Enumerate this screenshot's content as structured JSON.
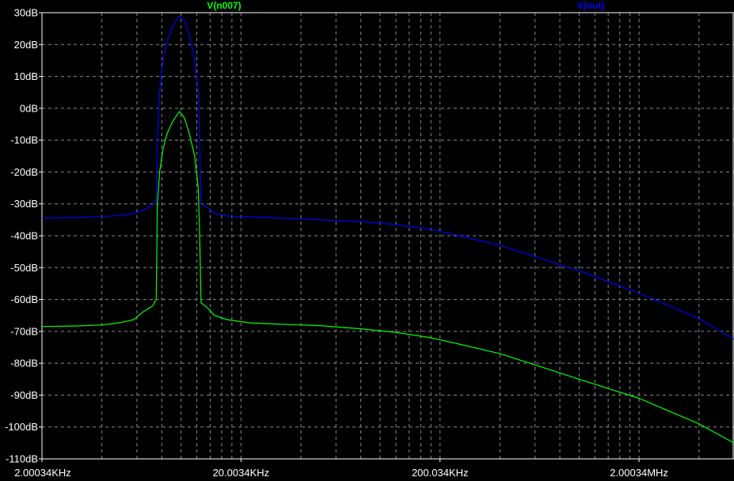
{
  "chart_data": {
    "type": "line",
    "title": "",
    "xlabel": "",
    "ylabel": "",
    "x_scale": "log",
    "xlim": [
      2000.34,
      6000000
    ],
    "ylim": [
      -110,
      30
    ],
    "y_tick_step": 10,
    "y_ticks": [
      30,
      20,
      10,
      0,
      -10,
      -20,
      -30,
      -40,
      -50,
      -60,
      -70,
      -80,
      -90,
      -100,
      -110
    ],
    "y_tick_labels": [
      "30dB",
      "20dB",
      "10dB",
      "0dB",
      "-10dB",
      "-20dB",
      "-30dB",
      "-40dB",
      "-50dB",
      "-60dB",
      "-70dB",
      "-80dB",
      "-90dB",
      "-100dB",
      "-110dB"
    ],
    "x_ticks": [
      2000.34,
      20003.4,
      200034,
      2000340
    ],
    "x_tick_labels": [
      "2.00034KHz",
      "20.0034KHz",
      "200.034KHz",
      "2.00034MHz"
    ],
    "grid": true,
    "legend_placement": "top",
    "series": [
      {
        "name": "V(n007)",
        "color": "#00ff00",
        "points": [
          [
            2000.34,
            -68.5
          ],
          [
            3000,
            -68.3
          ],
          [
            4000,
            -68
          ],
          [
            5000,
            -67.2
          ],
          [
            5800,
            -66.3
          ],
          [
            6400,
            -64
          ],
          [
            7200,
            -62
          ],
          [
            7500,
            -60
          ],
          [
            7600,
            -30
          ],
          [
            7800,
            -20
          ],
          [
            8100,
            -13
          ],
          [
            8500,
            -8
          ],
          [
            9100,
            -4
          ],
          [
            9800,
            -1
          ],
          [
            10400,
            -3
          ],
          [
            11000,
            -8
          ],
          [
            11700,
            -15
          ],
          [
            12200,
            -25
          ],
          [
            12400,
            -40
          ],
          [
            12600,
            -61
          ],
          [
            13800,
            -63
          ],
          [
            14700,
            -65
          ],
          [
            17000,
            -66.3
          ],
          [
            22000,
            -67.3
          ],
          [
            30000,
            -67.7
          ],
          [
            50000,
            -68.2
          ],
          [
            80000,
            -69.2
          ],
          [
            120000,
            -70.3
          ],
          [
            180000,
            -72
          ],
          [
            250000,
            -74
          ],
          [
            400000,
            -77
          ],
          [
            600000,
            -80.5
          ],
          [
            1000000,
            -85
          ],
          [
            2000000,
            -91
          ],
          [
            4000000,
            -99
          ],
          [
            6000000,
            -105
          ]
        ]
      },
      {
        "name": "V(out)",
        "color": "#0000ff",
        "points": [
          [
            2000.34,
            -34.5
          ],
          [
            3000,
            -34.3
          ],
          [
            4000,
            -34
          ],
          [
            5000,
            -33.6
          ],
          [
            5800,
            -33
          ],
          [
            6400,
            -32
          ],
          [
            7200,
            -30.5
          ],
          [
            7500,
            -29
          ],
          [
            7600,
            -10
          ],
          [
            7800,
            5
          ],
          [
            8100,
            15
          ],
          [
            8500,
            21
          ],
          [
            9100,
            26
          ],
          [
            9800,
            29
          ],
          [
            10400,
            27.5
          ],
          [
            11000,
            23
          ],
          [
            11700,
            15
          ],
          [
            12200,
            5
          ],
          [
            12400,
            -10
          ],
          [
            12600,
            -30
          ],
          [
            13800,
            -31.5
          ],
          [
            14700,
            -33
          ],
          [
            17000,
            -33.8
          ],
          [
            25000,
            -34.2
          ],
          [
            50000,
            -35
          ],
          [
            80000,
            -35.5
          ],
          [
            120000,
            -36.5
          ],
          [
            180000,
            -38
          ],
          [
            250000,
            -40
          ],
          [
            400000,
            -43
          ],
          [
            600000,
            -46.5
          ],
          [
            1000000,
            -51
          ],
          [
            2000000,
            -58
          ],
          [
            4000000,
            -66
          ],
          [
            6000000,
            -72.5
          ]
        ]
      }
    ]
  }
}
